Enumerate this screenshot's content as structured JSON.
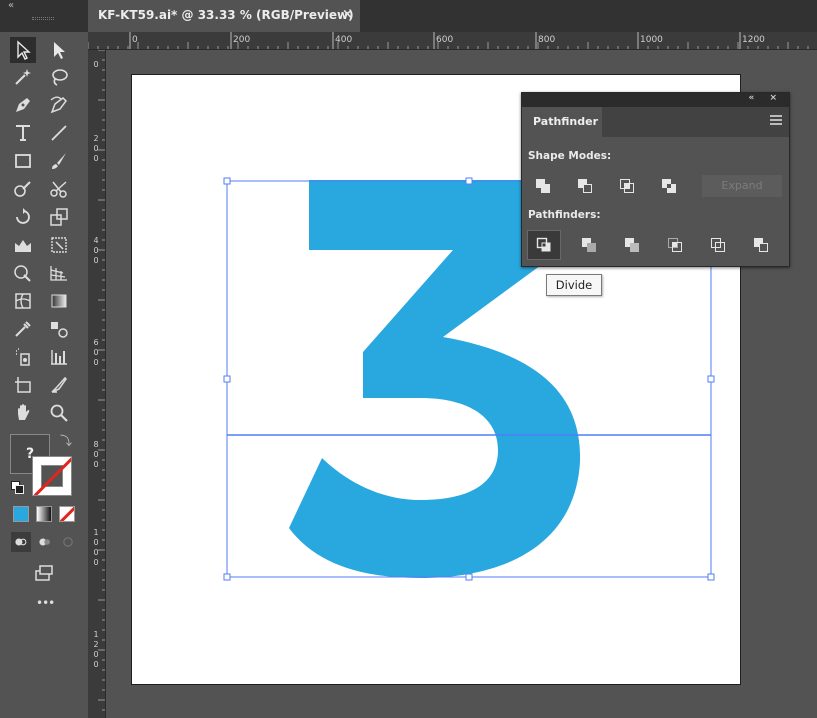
{
  "document_tab": {
    "title": "KF-KT59.ai* @ 33.33 % (RGB/Preview)",
    "close": "×"
  },
  "toolbar": {
    "collapse": "«",
    "fill_label": "?",
    "more": "•••",
    "tools": [
      "selection-tool",
      "direct-selection-tool",
      "magic-wand-tool",
      "lasso-tool",
      "pen-tool",
      "curvature-tool",
      "type-tool",
      "line-segment-tool",
      "rectangle-tool",
      "paintbrush-tool",
      "shaper-tool",
      "scissors-tool",
      "rotate-tool",
      "scale-tool",
      "puppet-warp-tool",
      "free-transform-tool",
      "shape-builder-tool",
      "perspective-grid-tool",
      "mesh-tool",
      "gradient-tool",
      "eyedropper-tool",
      "blend-tool",
      "symbol-sprayer-tool",
      "column-graph-tool",
      "artboard-tool",
      "slice-tool",
      "hand-tool",
      "zoom-tool"
    ]
  },
  "ruler_top": {
    "labels": [
      "0",
      "200",
      "400",
      "600",
      "800",
      "1000",
      "1200"
    ]
  },
  "ruler_left": {
    "labels": [
      "0",
      "200",
      "400",
      "600",
      "800",
      "1000",
      "1200"
    ]
  },
  "pathfinder": {
    "tab_label": "Pathfinder",
    "panel_controls": "« ×",
    "shape_modes_label": "Shape Modes:",
    "shape_modes": [
      "unite",
      "minus-front",
      "intersect",
      "exclude"
    ],
    "expand_label": "Expand",
    "pathfinders_label": "Pathfinders:",
    "pathfinders": [
      "divide",
      "trim",
      "merge",
      "crop",
      "outline",
      "minus-back"
    ]
  },
  "tooltip": {
    "text": "Divide"
  },
  "artwork": {
    "glyph_color": "#29A8E0",
    "selection_color": "#4F7EF7"
  },
  "colors": {
    "fill_mode_color": "#29A8E0"
  }
}
